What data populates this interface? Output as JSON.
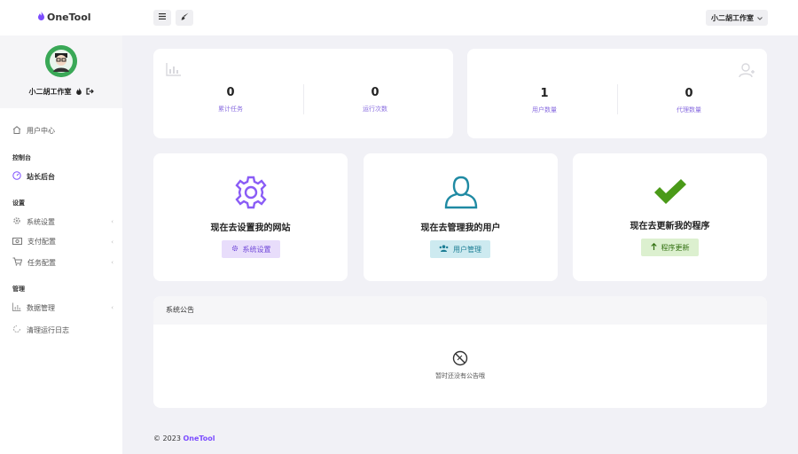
{
  "app": {
    "name": "OneTool"
  },
  "header": {
    "user_menu_label": "小二胡工作室"
  },
  "profile": {
    "name": "小二胡工作室"
  },
  "sidebar": {
    "items": [
      {
        "label": "用户中心"
      },
      {
        "section": "控制台"
      },
      {
        "label": "站长后台"
      },
      {
        "section": "设置"
      },
      {
        "label": "系统设置"
      },
      {
        "label": "支付配置"
      },
      {
        "label": "任务配置"
      },
      {
        "section": "管理"
      },
      {
        "label": "数据管理"
      },
      {
        "label": "清理运行日志"
      }
    ]
  },
  "stats_left": [
    {
      "value": "0",
      "label": "累计任务"
    },
    {
      "value": "0",
      "label": "运行次数"
    }
  ],
  "stats_right": [
    {
      "value": "1",
      "label": "用户数量"
    },
    {
      "value": "0",
      "label": "代理数量"
    }
  ],
  "features": [
    {
      "title": "现在去设置我的网站",
      "button": "系统设置",
      "color": "#8a5cf6",
      "bg": "#e8ddfb"
    },
    {
      "title": "现在去管理我的用户",
      "button": "用户管理",
      "color": "#1f8aa3",
      "bg": "#cdeaf0"
    },
    {
      "title": "现在去更新我的程序",
      "button": "程序更新",
      "color": "#4a9a18",
      "bg": "#dcf0cf"
    }
  ],
  "notice": {
    "title": "系统公告",
    "empty_text": "暂时还没有公告哦"
  },
  "footer": {
    "prefix": "© 2023",
    "brand": "OneTool"
  },
  "colors": {
    "accent": "#7c4dff",
    "sidebar_bg": "#ffffff",
    "page_bg": "#f1f1f6"
  }
}
